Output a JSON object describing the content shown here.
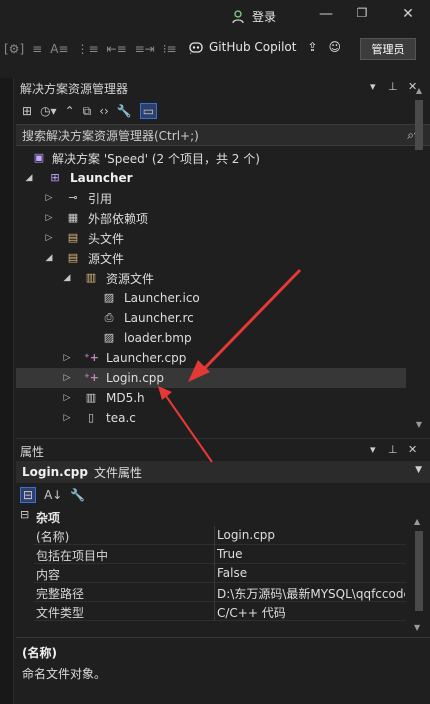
{
  "titlebar": {
    "login_label": "登录"
  },
  "toolbar": {
    "copilot_label": "GitHub Copilot",
    "admin_label": "管理员"
  },
  "solution_explorer": {
    "title": "解决方案资源管理器",
    "search_placeholder": "搜索解决方案资源管理器(Ctrl+;)",
    "items": [
      {
        "label": "解决方案 'Speed' (2 个项目，共 2 个)",
        "icon": "solution-icon"
      },
      {
        "label": "Launcher",
        "icon": "project-icon"
      },
      {
        "label": "引用",
        "icon": "references-icon"
      },
      {
        "label": "外部依赖项",
        "icon": "external-deps-icon"
      },
      {
        "label": "头文件",
        "icon": "folder-icon"
      },
      {
        "label": "源文件",
        "icon": "folder-icon"
      },
      {
        "label": "资源文件",
        "icon": "folder-open-icon"
      },
      {
        "label": "Launcher.ico",
        "icon": "image-file-icon"
      },
      {
        "label": "Launcher.rc",
        "icon": "resource-file-icon"
      },
      {
        "label": "loader.bmp",
        "icon": "image-file-icon"
      },
      {
        "label": "Launcher.cpp",
        "icon": "cpp-file-icon"
      },
      {
        "label": "Login.cpp",
        "icon": "cpp-file-icon"
      },
      {
        "label": "MD5.h",
        "icon": "header-file-icon"
      },
      {
        "label": "tea.c",
        "icon": "c-file-icon"
      }
    ]
  },
  "properties": {
    "title": "属性",
    "object_name": "Login.cpp",
    "object_kind": "文件属性",
    "category": "杂项",
    "rows": [
      {
        "name": "(名称)",
        "value": "Login.cpp"
      },
      {
        "name": "包括在项目中",
        "value": "True"
      },
      {
        "name": "内容",
        "value": "False"
      },
      {
        "name": "完整路径",
        "value": "D:\\东万源码\\最新MYSQL\\qqfccode"
      },
      {
        "name": "文件类型",
        "value": "C/C++ 代码"
      }
    ],
    "description_title": "(名称)",
    "description_text": "命名文件对象。"
  },
  "colors": {
    "accent": "#3b6fd6",
    "annotation_arrow": "#e53935"
  }
}
